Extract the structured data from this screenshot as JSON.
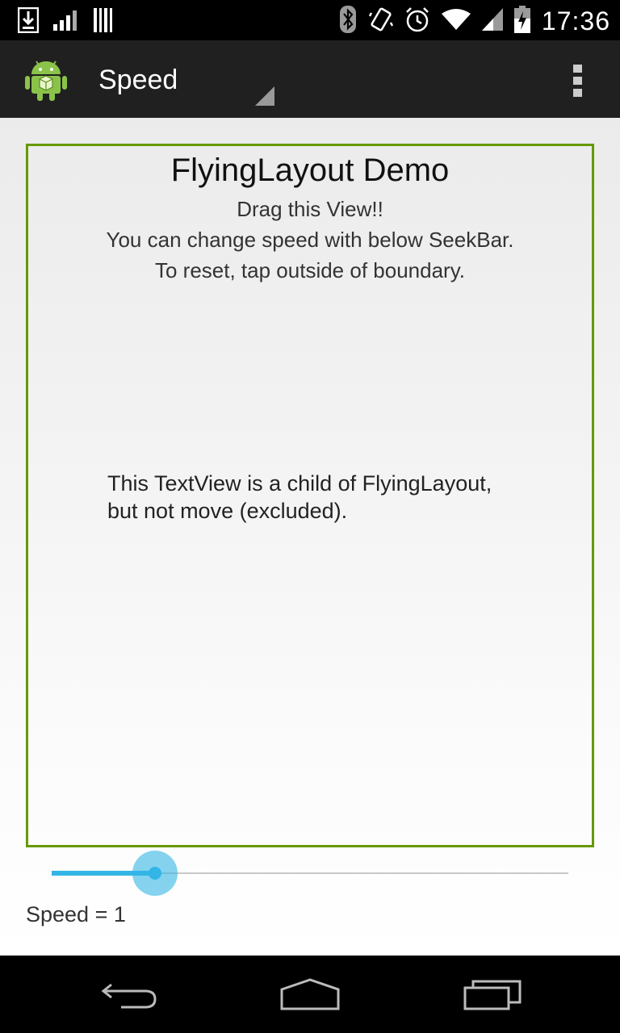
{
  "status_bar": {
    "time": "17:36",
    "left_icons": [
      "download-icon",
      "signal-bars-icon",
      "barcode-icon"
    ],
    "right_icons": [
      "bluetooth-icon",
      "vibrate-icon",
      "alarm-icon",
      "wifi-icon",
      "cell-signal-icon",
      "battery-charging-icon"
    ]
  },
  "action_bar": {
    "app_icon": "android-icon",
    "spinner_label": "Speed",
    "overflow_icon": "overflow-menu-icon"
  },
  "demo": {
    "title": "FlyingLayout Demo",
    "lines": [
      "Drag this View!!",
      "You can change speed with below SeekBar.",
      "To reset, tap outside of boundary."
    ],
    "child_text_line1": "This TextView is a child of FlyingLayout,",
    "child_text_line2": "but not move (excluded).",
    "border_color": "#669900"
  },
  "seekbar": {
    "progress": 0.2,
    "accent_color": "#33b5e5"
  },
  "speed_label": "Speed = 1",
  "nav_bar": {
    "icons": [
      "back-icon",
      "home-icon",
      "recents-icon"
    ]
  }
}
